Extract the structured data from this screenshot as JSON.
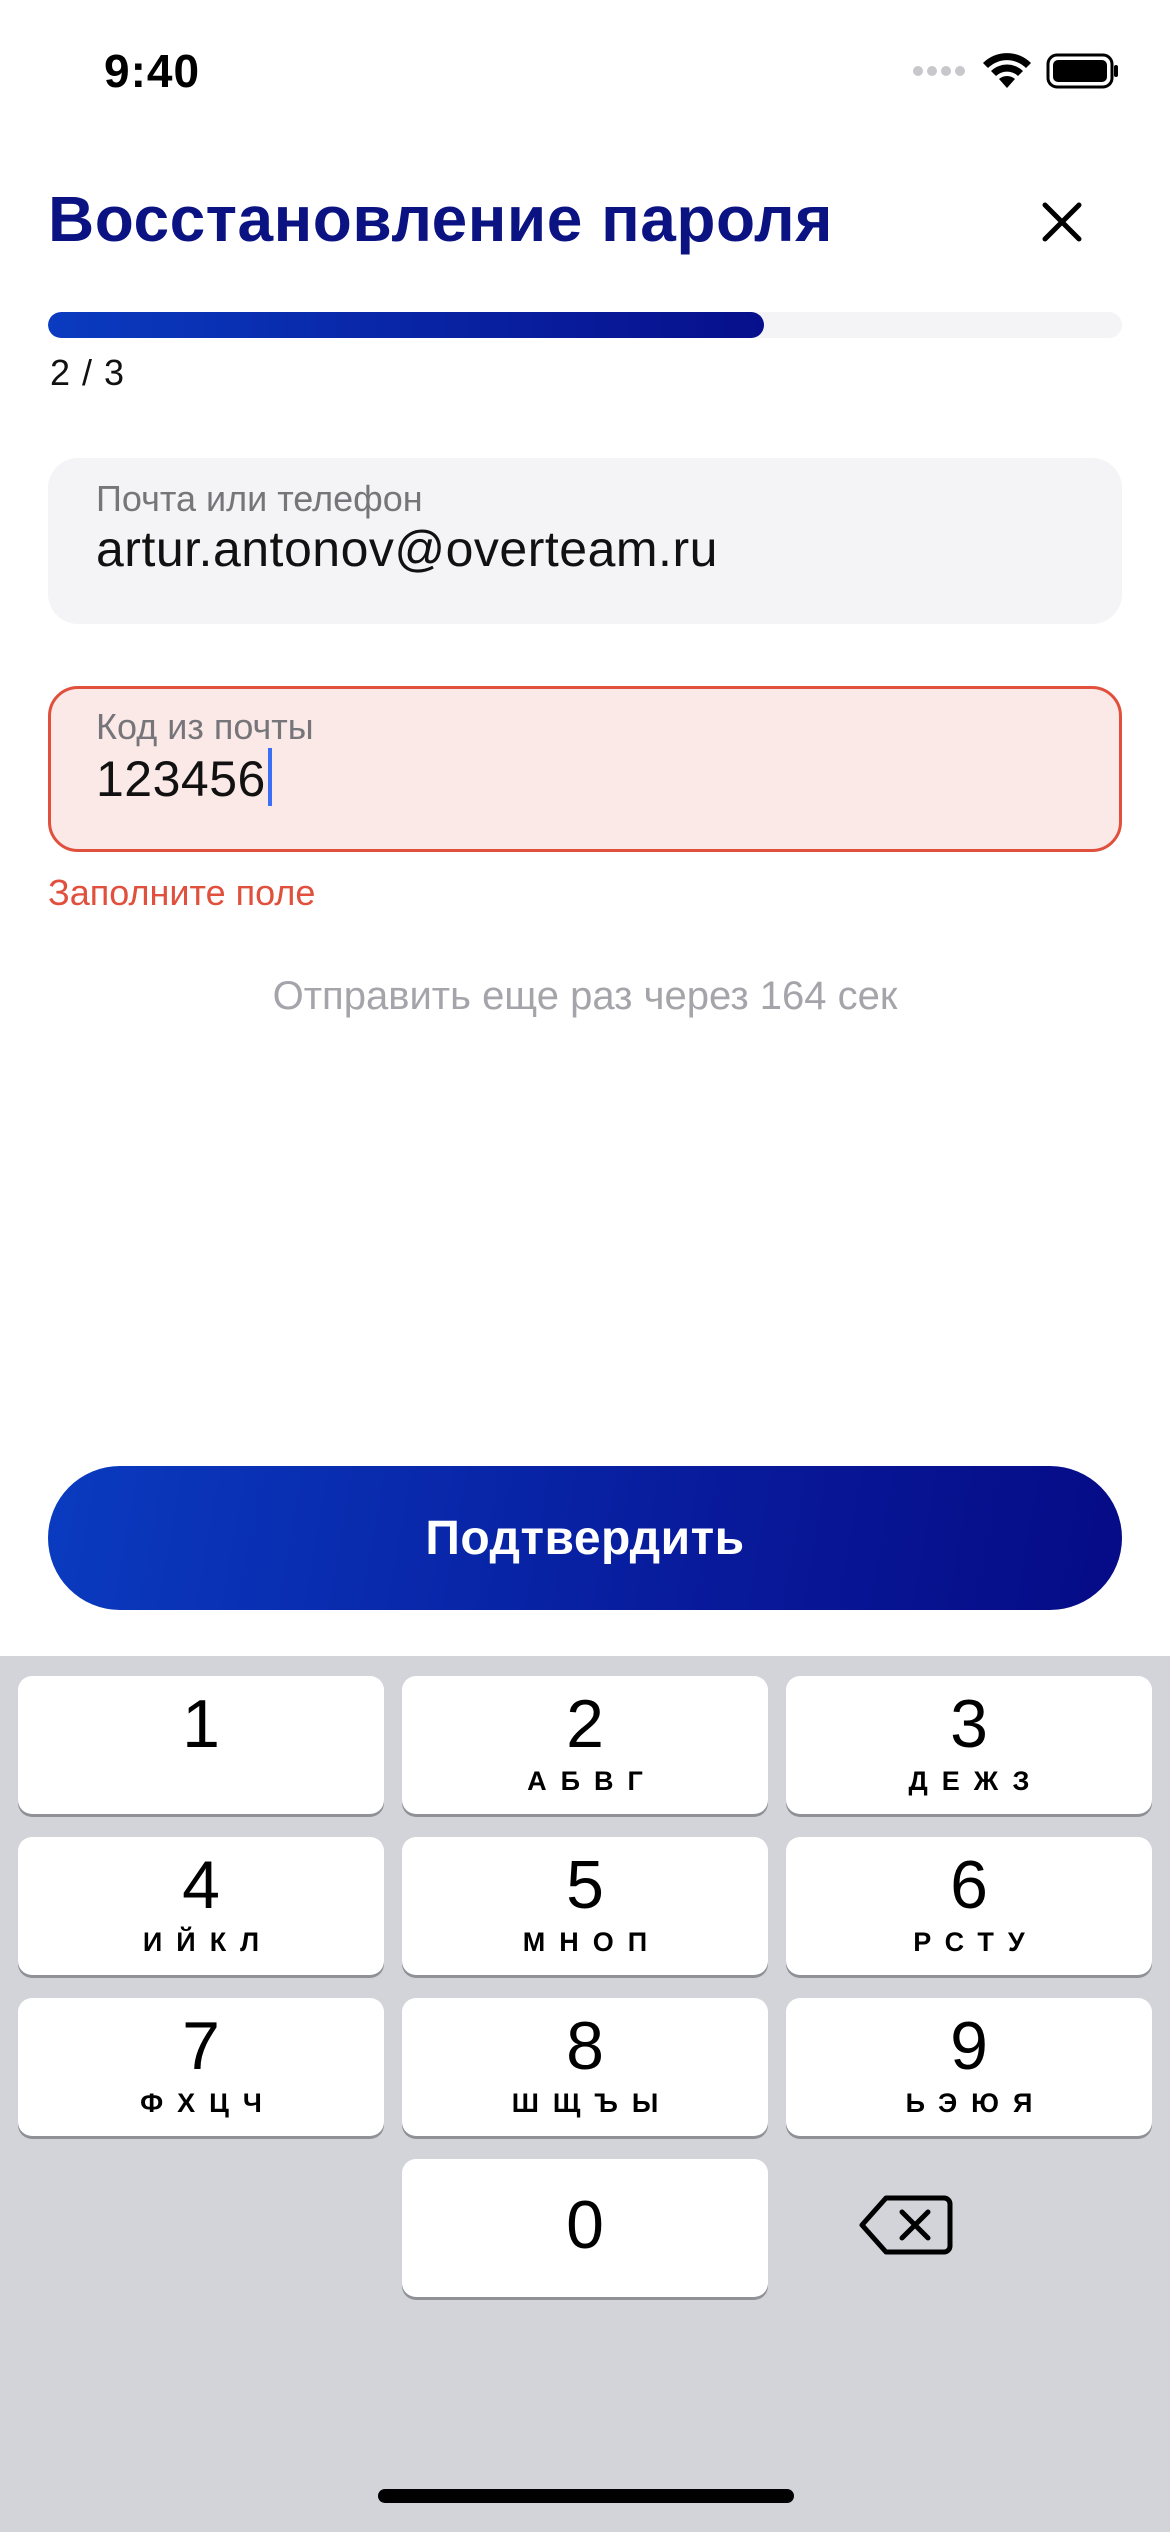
{
  "status_bar": {
    "time": "9:40",
    "icons": [
      "signal-icon",
      "wifi-icon",
      "battery-icon"
    ]
  },
  "header": {
    "title": "Восстановление пароля",
    "close_icon": "close-icon"
  },
  "progress": {
    "label": "2 / 3",
    "fraction": 0.667,
    "color": "#0a3bc0"
  },
  "fields": {
    "email": {
      "label": "Почта или телефон",
      "value": "artur.antonov@overteam.ru"
    },
    "code": {
      "label": "Код из почты",
      "value": "123456",
      "error": "Заполните поле"
    }
  },
  "resend_text": "Отправить еще раз через 164 сек",
  "confirm_button": "Подтвердить",
  "keyboard": {
    "keys": [
      {
        "digit": "1",
        "letters": ""
      },
      {
        "digit": "2",
        "letters": "АБВГ"
      },
      {
        "digit": "3",
        "letters": "ДЕЖЗ"
      },
      {
        "digit": "4",
        "letters": "ИЙКЛ"
      },
      {
        "digit": "5",
        "letters": "МНОП"
      },
      {
        "digit": "6",
        "letters": "РСТУ"
      },
      {
        "digit": "7",
        "letters": "ФХЦЧ"
      },
      {
        "digit": "8",
        "letters": "ШЩЪЫ"
      },
      {
        "digit": "9",
        "letters": "ЬЭЮЯ"
      },
      {
        "digit": "0",
        "letters": ""
      }
    ],
    "backspace_icon": "backspace-icon"
  },
  "colors": {
    "accent": "#0b1383",
    "error": "#e0503c",
    "error_bg": "#fbe9e8"
  }
}
